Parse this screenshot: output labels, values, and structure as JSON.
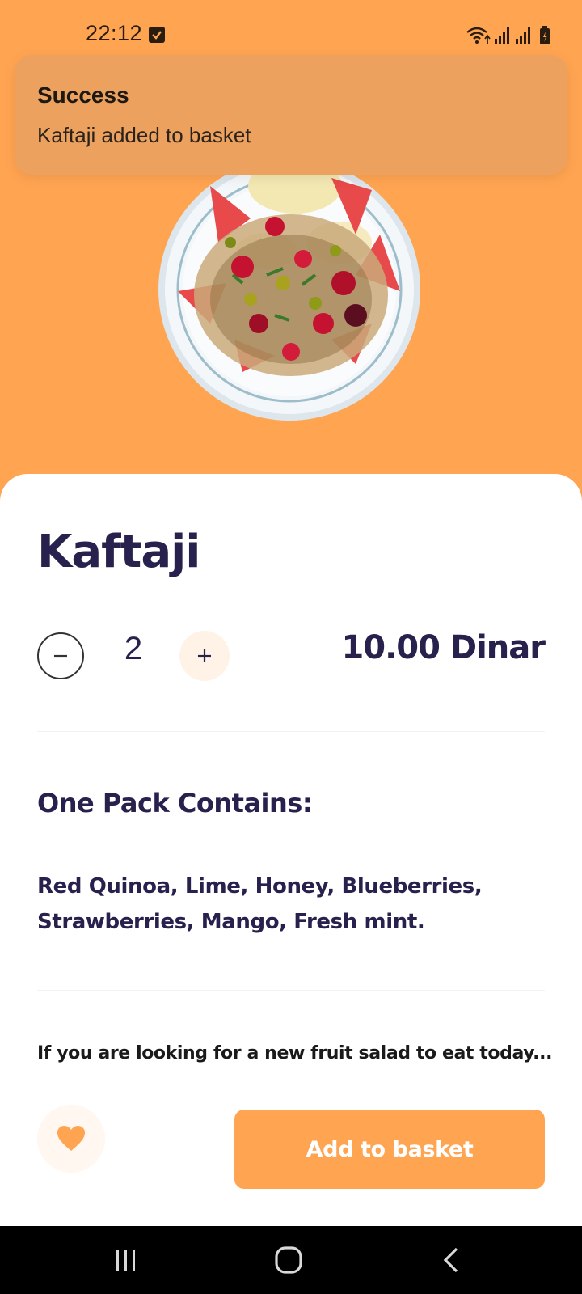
{
  "status_bar": {
    "time": "22:12",
    "icons": [
      "task-check-icon",
      "wifi-icon",
      "signal-icon",
      "signal-icon",
      "battery-icon"
    ]
  },
  "toast": {
    "title": "Success",
    "message": "Kaftaji added to basket"
  },
  "product": {
    "image": "fruit-salad-plate",
    "name": "Kaftaji",
    "quantity": "2",
    "price": "10.00 Dinar",
    "decrement_icon": "minus-icon",
    "increment_icon": "plus-icon"
  },
  "contents": {
    "heading": "One Pack Contains:",
    "ingredients": "Red Quinoa, Lime, Honey, Blueberries, Strawberries, Mango, Fresh mint."
  },
  "description": "If you are looking for a new fruit salad to eat today...",
  "actions": {
    "favorite_icon": "heart-icon",
    "add_to_basket_label": "Add to basket"
  },
  "nav_bar": {
    "buttons": [
      "recent-apps-icon",
      "home-icon",
      "back-icon"
    ]
  },
  "colors": {
    "accent": "#FFA451",
    "title_text": "#27214D",
    "toast_bg": "#ECA25E",
    "nav_bar": "#000000"
  }
}
